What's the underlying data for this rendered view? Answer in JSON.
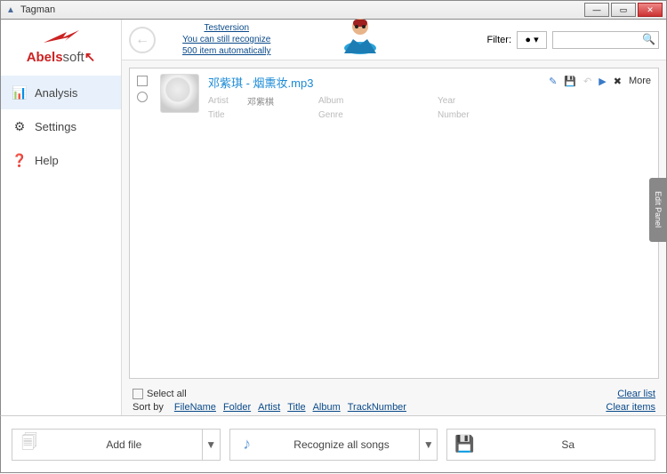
{
  "app": {
    "title": "Tagman"
  },
  "sidebar": {
    "brand1": "Abels",
    "brand2": "soft",
    "items": [
      {
        "label": "Analysis",
        "icon": "chart"
      },
      {
        "label": "Settings",
        "icon": "gear"
      },
      {
        "label": "Help",
        "icon": "help"
      }
    ]
  },
  "header": {
    "promo1": "Testversion",
    "promo2": "You can still recognize",
    "promo3": "500 item automatically",
    "filter_label": "Filter:"
  },
  "track": {
    "title": "邓紫琪 - 烟熏妆.mp3",
    "artist_label": "Artist",
    "artist": "邓紫棋",
    "album_label": "Album",
    "album": "",
    "year_label": "Year",
    "year": "",
    "title_label": "Title",
    "title_val": "",
    "genre_label": "Genre",
    "genre": "",
    "number_label": "Number",
    "number": "",
    "more": "More"
  },
  "footer": {
    "select_all": "Select all",
    "sort_by": "Sort by",
    "sorters": [
      "FileName",
      "Folder",
      "Artist",
      "Title",
      "Album",
      "TrackNumber"
    ],
    "clear_list": "Clear list",
    "clear_items": "Clear items"
  },
  "toolbar": {
    "add_file": "Add file",
    "recognize": "Recognize all songs",
    "save": "Sa"
  },
  "edit_panel": "Edit Panel"
}
